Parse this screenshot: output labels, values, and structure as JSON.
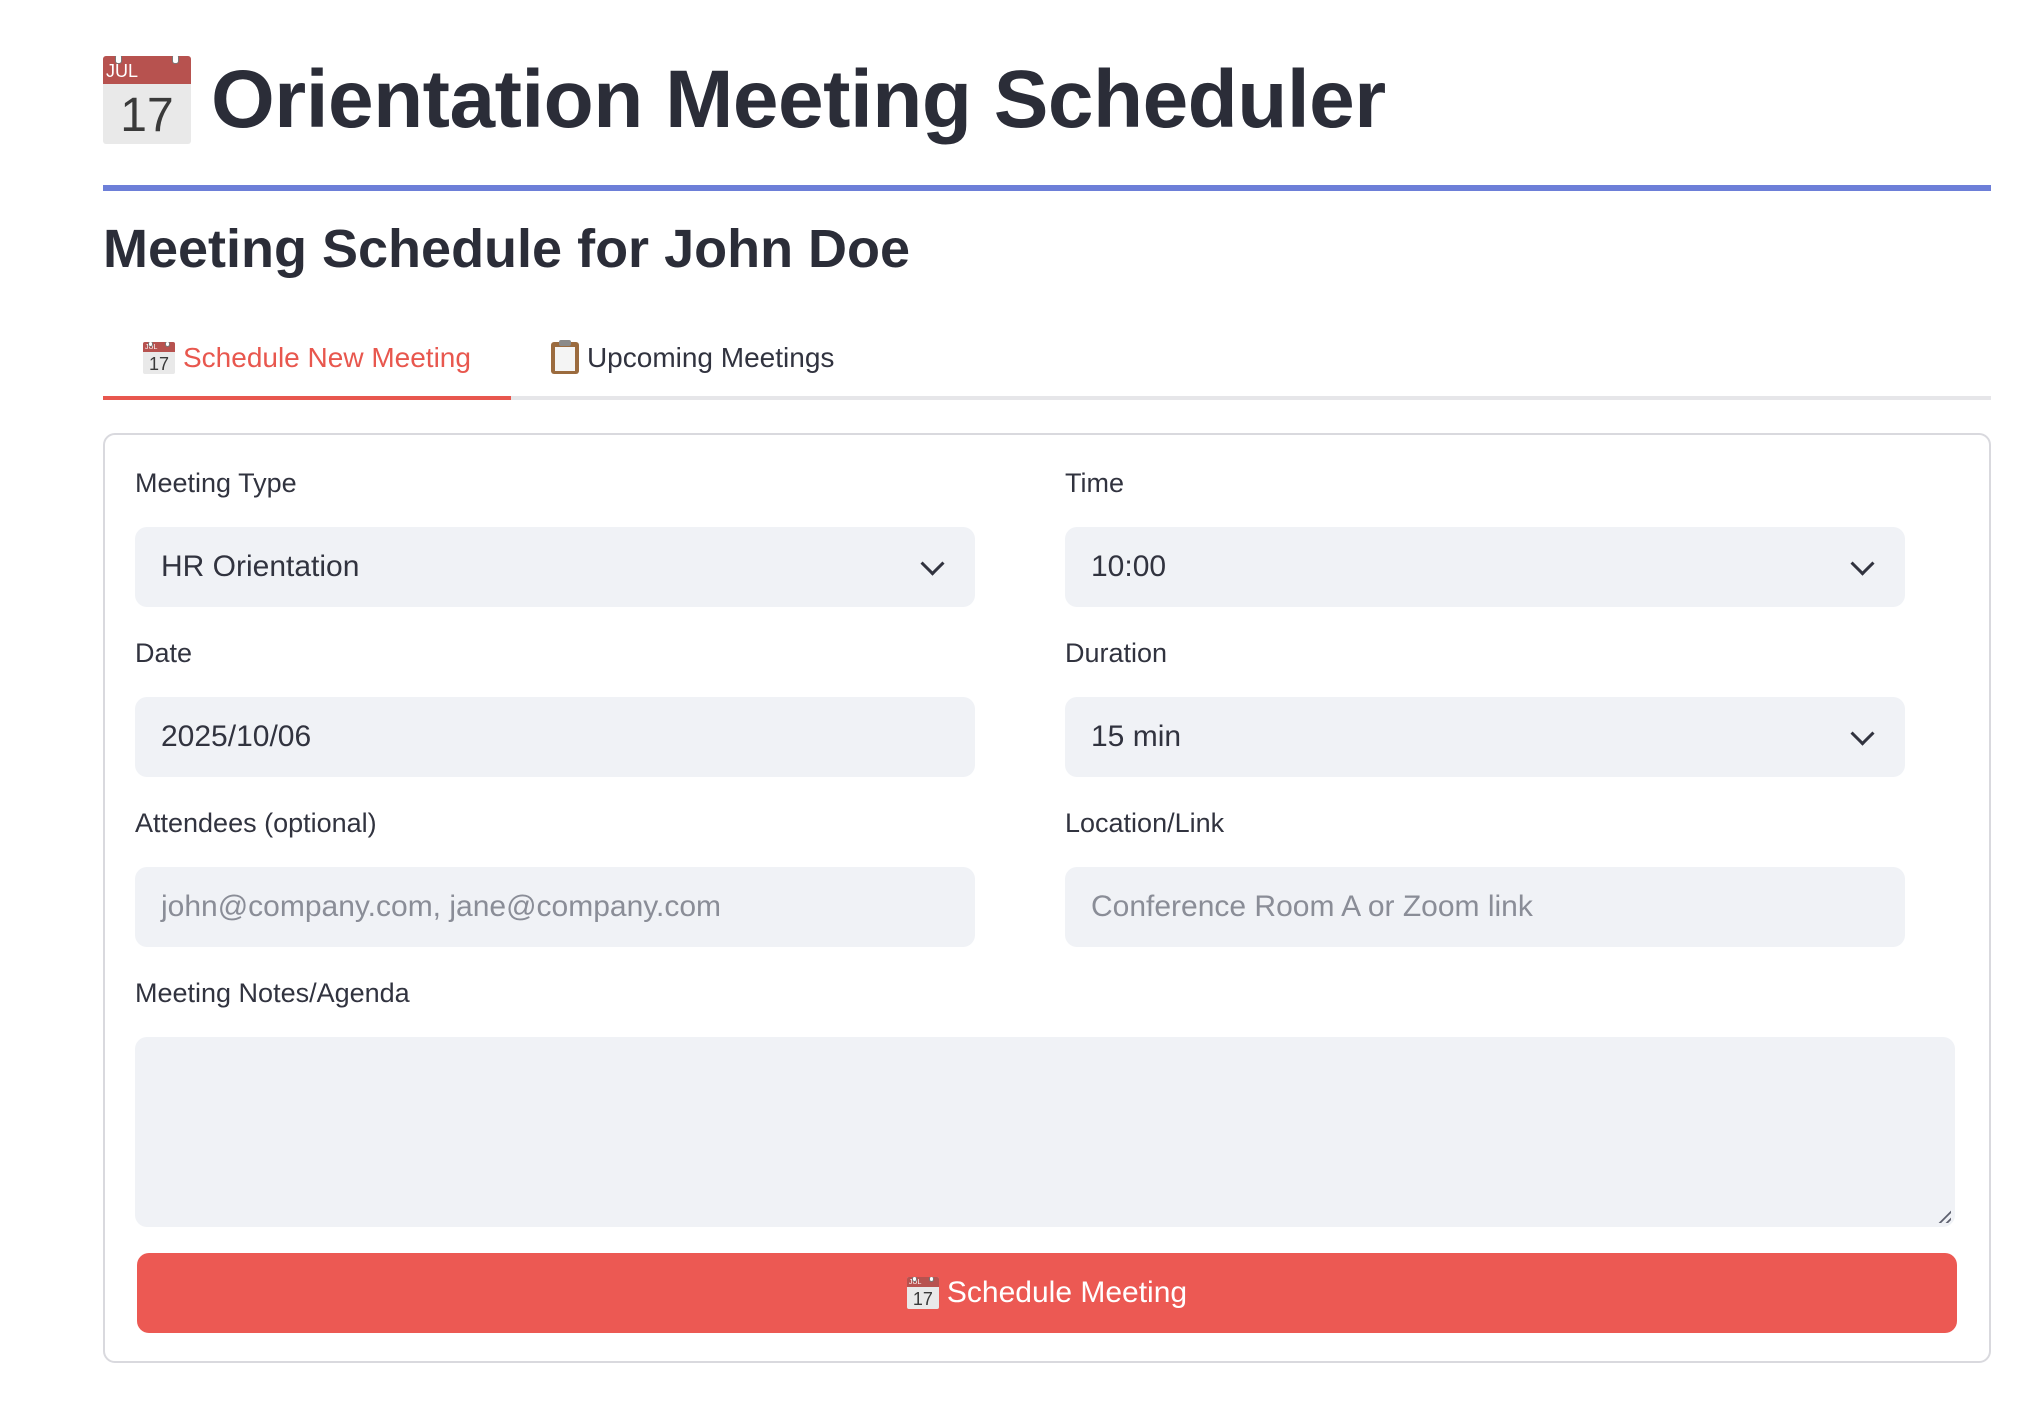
{
  "header": {
    "icon": "calendar-icon",
    "icon_month": "JUL",
    "icon_day": "17",
    "title": "Orientation Meeting Scheduler",
    "rule_color": "#6d7fd8"
  },
  "subtitle": "Meeting Schedule for John Doe",
  "tabs": [
    {
      "label": "Schedule New Meeting",
      "icon": "calendar-icon",
      "active": true
    },
    {
      "label": "Upcoming Meetings",
      "icon": "clipboard-icon",
      "active": false
    }
  ],
  "form": {
    "meeting_type": {
      "label": "Meeting Type",
      "value": "HR Orientation"
    },
    "time": {
      "label": "Time",
      "value": "10:00"
    },
    "date": {
      "label": "Date",
      "value": "2025/10/06"
    },
    "duration": {
      "label": "Duration",
      "value": "15 min"
    },
    "attendees": {
      "label": "Attendees (optional)",
      "placeholder": "john@company.com, jane@company.com"
    },
    "location": {
      "label": "Location/Link",
      "placeholder": "Conference Room A or Zoom link"
    },
    "notes": {
      "label": "Meeting Notes/Agenda",
      "value": ""
    },
    "submit_label": "Schedule Meeting"
  },
  "colors": {
    "accent": "#e8574e",
    "button": "#ec5953",
    "input_bg": "#f0f2f6"
  }
}
